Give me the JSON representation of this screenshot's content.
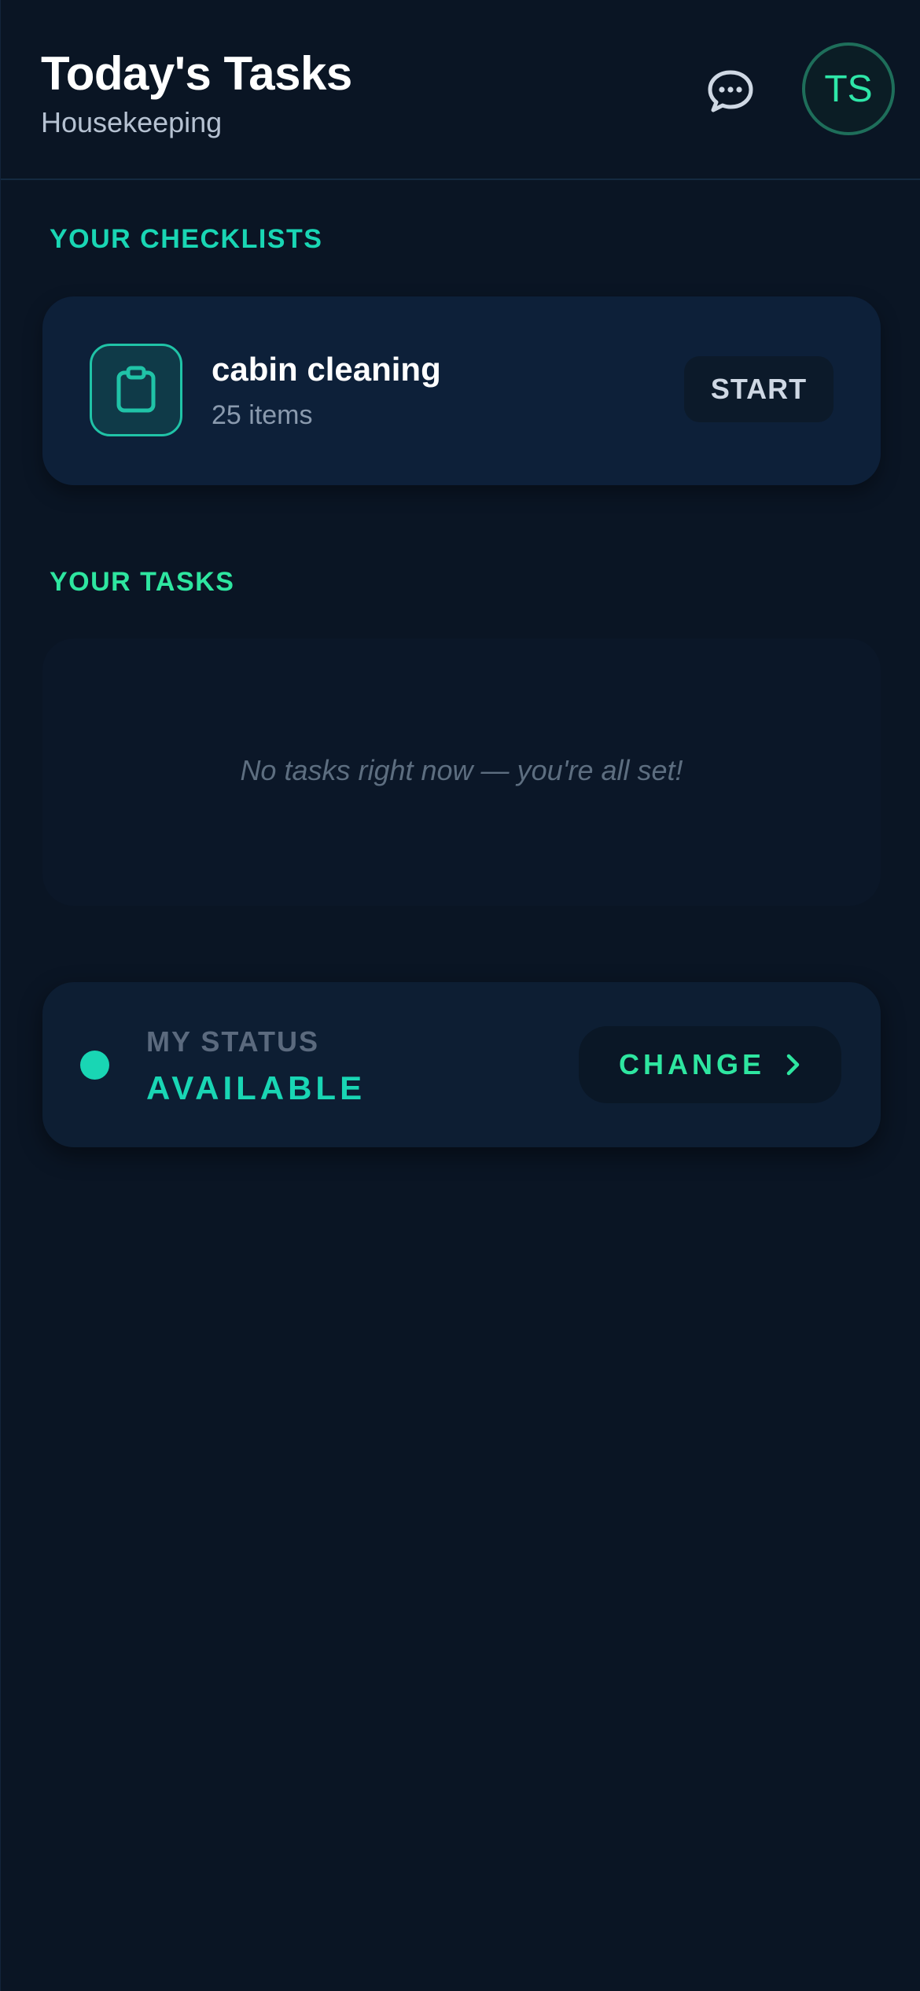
{
  "header": {
    "title": "Today's Tasks",
    "subtitle": "Housekeeping",
    "chat_icon": "chat-bubble-icon",
    "avatar_initials": "TS"
  },
  "checklists": {
    "heading": "YOUR CHECKLISTS",
    "items": [
      {
        "icon": "clipboard-icon",
        "title": "cabin cleaning",
        "count": "25 items",
        "action_label": "START"
      }
    ]
  },
  "tasks": {
    "heading": "YOUR TASKS",
    "empty_message": "No tasks right now — you're all set!"
  },
  "status": {
    "label": "MY STATUS",
    "value": "AVAILABLE",
    "change_label": "CHANGE",
    "change_icon": "chevron-right-icon"
  },
  "colors": {
    "background": "#0a1524",
    "accent_teal": "#19d6b4",
    "accent_green": "#2ee6a0",
    "card": "#0d2039"
  }
}
